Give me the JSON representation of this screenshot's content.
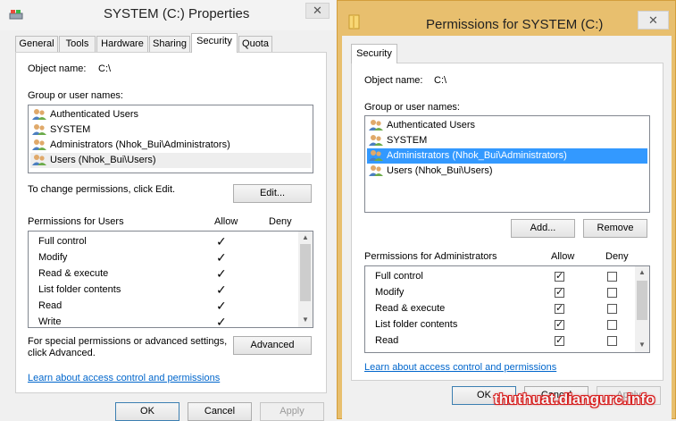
{
  "win1": {
    "title": "SYSTEM (C:) Properties",
    "close": "✕",
    "tabs": [
      "General",
      "Tools",
      "Hardware",
      "Sharing",
      "Security",
      "Quota"
    ],
    "active_tab": "Security",
    "object_label": "Object name:",
    "object_value": "C:\\",
    "group_label": "Group or user names:",
    "users": [
      "Authenticated Users",
      "SYSTEM",
      "Administrators (Nhok_Bui\\Administrators)",
      "Users (Nhok_Bui\\Users)"
    ],
    "selected_user_index": 3,
    "change_text": "To change permissions, click Edit.",
    "edit_button": "Edit...",
    "perm_header": "Permissions for Users",
    "allow_header": "Allow",
    "deny_header": "Deny",
    "permissions": [
      "Full control",
      "Modify",
      "Read & execute",
      "List folder contents",
      "Read",
      "Write"
    ],
    "allow_checks": [
      "✓",
      "✓",
      "✓",
      "✓",
      "✓",
      "✓"
    ],
    "special_text_1": "For special permissions or advanced settings,",
    "special_text_2": "click Advanced.",
    "advanced_button": "Advanced",
    "learn_link": "Learn about access control and permissions",
    "ok_button": "OK",
    "cancel_button": "Cancel",
    "apply_button": "Apply"
  },
  "win2": {
    "title": "Permissions for SYSTEM (C:)",
    "close": "✕",
    "tab": "Security",
    "object_label": "Object name:",
    "object_value": "C:\\",
    "group_label": "Group or user names:",
    "users": [
      "Authenticated Users",
      "SYSTEM",
      "Administrators (Nhok_Bui\\Administrators)",
      "Users (Nhok_Bui\\Users)"
    ],
    "selected_user_index": 2,
    "add_button": "Add...",
    "remove_button": "Remove",
    "perm_header": "Permissions for Administrators",
    "allow_header": "Allow",
    "deny_header": "Deny",
    "permissions": [
      "Full control",
      "Modify",
      "Read & execute",
      "List folder contents",
      "Read"
    ],
    "allow_checked": [
      true,
      true,
      true,
      true,
      true
    ],
    "deny_checked": [
      false,
      false,
      false,
      false,
      false
    ],
    "learn_link": "Learn about access control and permissions",
    "ok_button": "OK",
    "cancel_button": "Cancel",
    "apply_button": "Apply"
  },
  "watermark": "thuthuat.diangurc.info",
  "colors": {
    "selection": "#3399ff",
    "link": "#0066cc",
    "frame_active": "#e8bf6e",
    "watermark_outline": "#d81b1b"
  }
}
